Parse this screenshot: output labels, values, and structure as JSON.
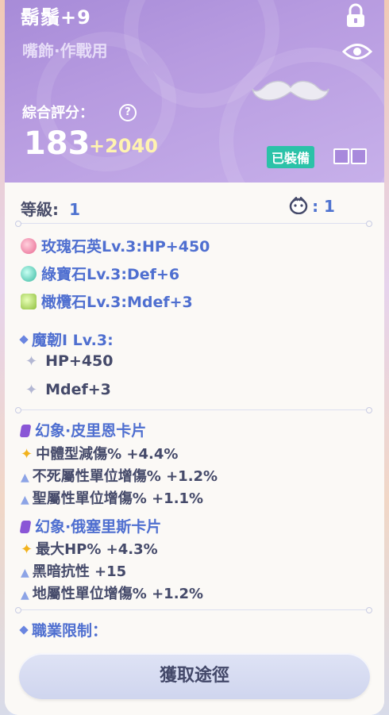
{
  "item": {
    "name": "鬍鬚+9",
    "type": "嘴飾·作戰用",
    "score_label": "綜合評分：",
    "score": "183",
    "score_bonus": "+2040",
    "equipped_label": "已裝備",
    "level_label": "等級:",
    "level_value": "1",
    "pet_value": ": 1"
  },
  "gems": [
    {
      "text": "玫瑰石英Lv.3:HP+450",
      "color": "#e8668f"
    },
    {
      "text": "綠寶石Lv.3:Def+6",
      "color": "#37b8a0"
    },
    {
      "text": "橄欖石Lv.3:Mdef+3",
      "color": "#8fbf3c"
    }
  ],
  "refine": {
    "title": "魔韌I Lv.3:",
    "stats": [
      "HP+450",
      "Mdef+3"
    ]
  },
  "cards": [
    {
      "title": "幻象·皮里恩卡片",
      "lines": [
        {
          "icon": "star",
          "text": "中體型減傷% +4.4%"
        },
        {
          "icon": "triangle",
          "text": "不死屬性單位增傷% +1.2%"
        },
        {
          "icon": "triangle",
          "text": "聖屬性單位增傷% +1.1%"
        }
      ]
    },
    {
      "title": "幻象·俄塞里斯卡片",
      "lines": [
        {
          "icon": "star",
          "text": "最大HP% +4.3%"
        },
        {
          "icon": "triangle",
          "text": "黑暗抗性 +15"
        },
        {
          "icon": "triangle",
          "text": "地屬性單位增傷% +1.2%"
        }
      ]
    }
  ],
  "job_limit_label": "職業限制：",
  "obtain_button": "獲取途徑"
}
